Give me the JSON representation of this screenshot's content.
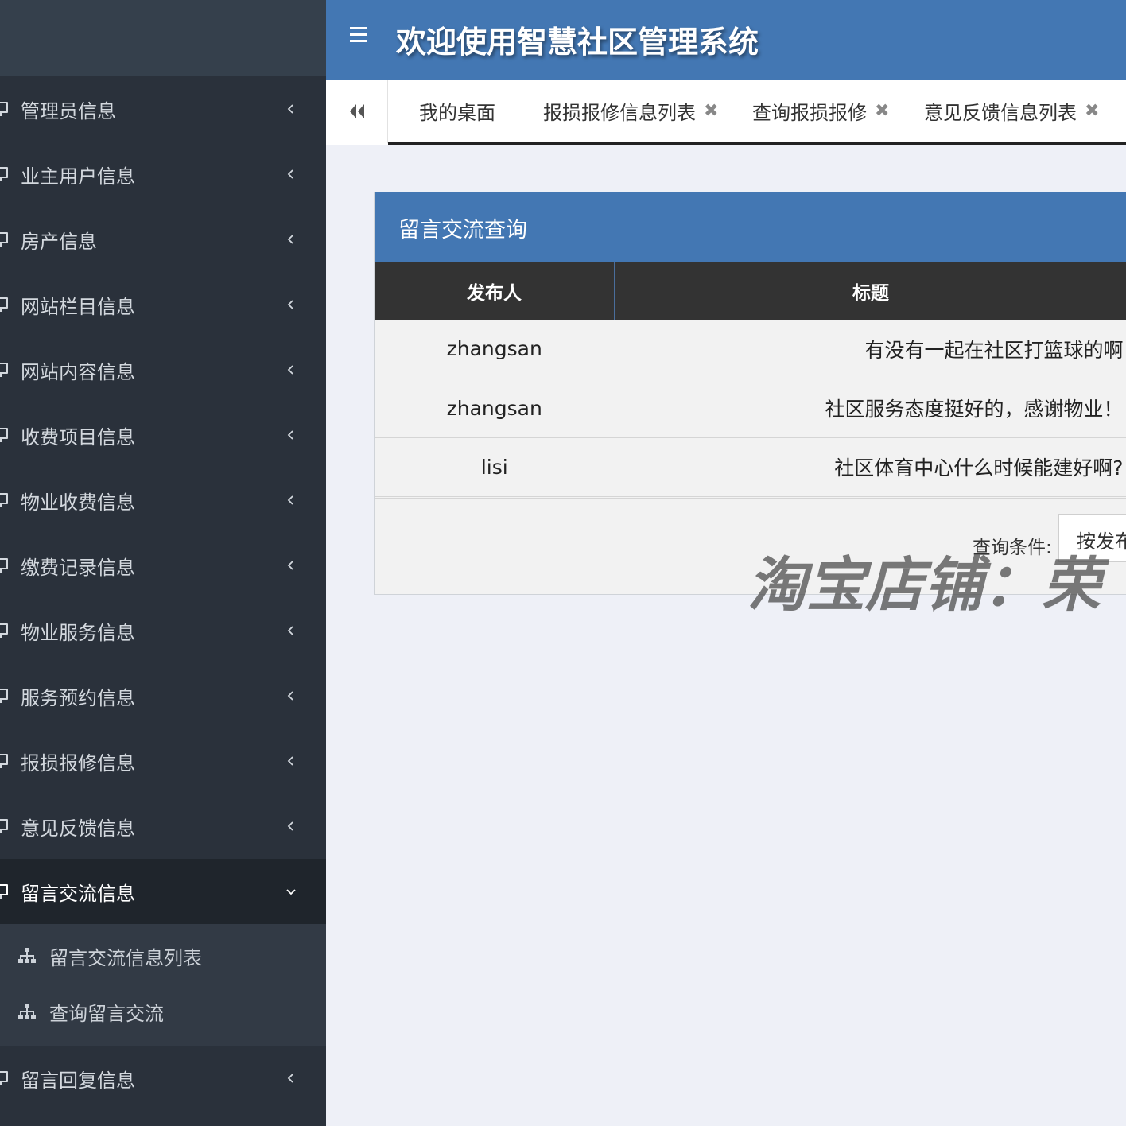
{
  "header": {
    "title": "欢迎使用智慧社区管理系统"
  },
  "sidebar": {
    "items": [
      {
        "label": "管理员信息"
      },
      {
        "label": "业主用户信息"
      },
      {
        "label": "房产信息"
      },
      {
        "label": "网站栏目信息"
      },
      {
        "label": "网站内容信息"
      },
      {
        "label": "收费项目信息"
      },
      {
        "label": "物业收费信息"
      },
      {
        "label": "缴费记录信息"
      },
      {
        "label": "物业服务信息"
      },
      {
        "label": "服务预约信息"
      },
      {
        "label": "报损报修信息"
      },
      {
        "label": "意见反馈信息"
      }
    ],
    "open_item": {
      "label": "留言交流信息",
      "children": [
        {
          "label": "留言交流信息列表"
        },
        {
          "label": "查询留言交流"
        }
      ]
    },
    "after_items": [
      {
        "label": "留言回复信息"
      }
    ]
  },
  "tabs": [
    {
      "label": "我的桌面",
      "closable": false
    },
    {
      "label": "报损报修信息列表",
      "closable": true
    },
    {
      "label": "查询报损报修",
      "closable": true
    },
    {
      "label": "意见反馈信息列表",
      "closable": true
    }
  ],
  "tab_close_glyph": "✖",
  "panel": {
    "title": "留言交流查询",
    "columns": [
      "发布人",
      "标题"
    ],
    "rows": [
      {
        "publisher": "zhangsan",
        "title": "有没有一起在社区打篮球的啊"
      },
      {
        "publisher": "zhangsan",
        "title": "社区服务态度挺好的，感谢物业！"
      },
      {
        "publisher": "lisi",
        "title": "社区体育中心什么时候能建好啊?"
      }
    ],
    "query_label": "查询条件:",
    "query_selected": "按发布人"
  },
  "watermark": "淘宝店铺：荣",
  "colors": {
    "header_blue": "#4377b3",
    "sidebar_bg": "#2a313b",
    "table_header": "#333333",
    "page_bg": "#eef0f7"
  }
}
